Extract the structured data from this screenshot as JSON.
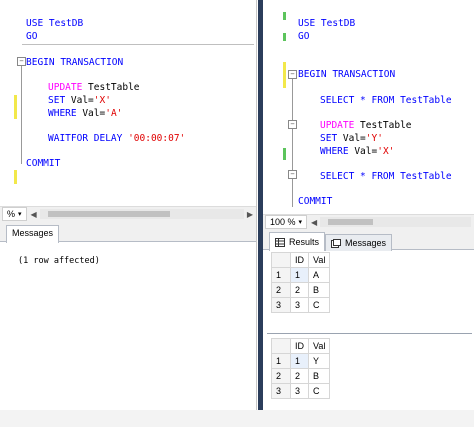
{
  "left_editor": {
    "lines": {
      "use": "USE TestDB",
      "go": "GO",
      "begin": "BEGIN TRANSACTION",
      "update_kw": "UPDATE",
      "update_tbl": " TestTable",
      "set_kw": "SET",
      "set_mid": " Val=",
      "set_val": "'X'",
      "where_kw": "WHERE",
      "where_mid": " Val=",
      "where_val": "'A'",
      "waitfor_kw": "WAITFOR DELAY ",
      "waitfor_val": "'00:00:07'",
      "commit": "COMMIT"
    },
    "zoom": "%"
  },
  "left_messages": {
    "tab_label": "Messages",
    "text": "(1 row affected)"
  },
  "right_editor": {
    "lines": {
      "use": "USE TestDB",
      "go": "GO",
      "begin": "BEGIN TRANSACTION",
      "select1": "SELECT * FROM TestTable",
      "update_kw": "UPDATE",
      "update_tbl": " TestTable",
      "set_kw": "SET",
      "set_mid": " Val=",
      "set_val": "'Y'",
      "where_kw": "WHERE",
      "where_mid": " Val=",
      "where_val": "'X'",
      "select2": "SELECT * FROM TestTable",
      "commit": "COMMIT"
    },
    "zoom": "100 %"
  },
  "right_results": {
    "tabs": [
      "Results",
      "Messages"
    ],
    "grid1": {
      "columns": [
        "ID",
        "Val"
      ],
      "rows": [
        {
          "rn": "1",
          "id": "1",
          "val": "A"
        },
        {
          "rn": "2",
          "id": "2",
          "val": "B"
        },
        {
          "rn": "3",
          "id": "3",
          "val": "C"
        }
      ]
    },
    "grid2": {
      "columns": [
        "ID",
        "Val"
      ],
      "rows": [
        {
          "rn": "1",
          "id": "1",
          "val": "Y"
        },
        {
          "rn": "2",
          "id": "2",
          "val": "B"
        },
        {
          "rn": "3",
          "id": "3",
          "val": "C"
        }
      ]
    }
  },
  "colors": {
    "keyword": "#0000ff",
    "string": "#e00000",
    "dml": "#ff00ff",
    "splitter": "#2b3d5b",
    "change_marker_yellow": "#f2e84a",
    "change_marker_green": "#5cc45c"
  }
}
